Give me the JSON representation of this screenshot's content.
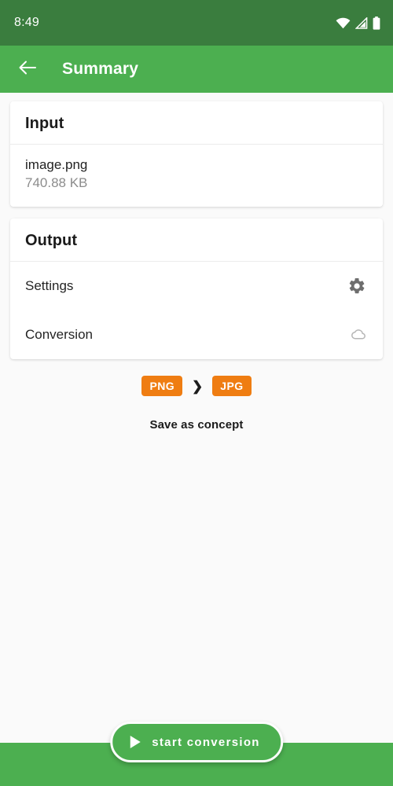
{
  "status_bar": {
    "time": "8:49",
    "icons": [
      "wifi-icon",
      "cellular-signal-icon",
      "battery-icon"
    ]
  },
  "app_bar": {
    "back_icon": "arrow-left-icon",
    "title": "Summary"
  },
  "cards": {
    "input": {
      "header": "Input",
      "file_name": "image.png",
      "file_size": "740.88 KB"
    },
    "output": {
      "header": "Output",
      "rows": [
        {
          "label": "Settings",
          "icon": "gear-icon"
        },
        {
          "label": "Conversion",
          "icon": "cloud-icon"
        }
      ]
    }
  },
  "format_conversion": {
    "source": "PNG",
    "separator": "❯",
    "target": "JPG"
  },
  "save_as_concept": "Save as concept",
  "primary_action": {
    "label": "start conversion",
    "icon": "play-icon"
  },
  "colors": {
    "status_bar": "#3a7d3e",
    "app_bar": "#4caf50",
    "accent_orange": "#ef7d12",
    "page_background": "#fafafa",
    "card_background": "#ffffff"
  }
}
